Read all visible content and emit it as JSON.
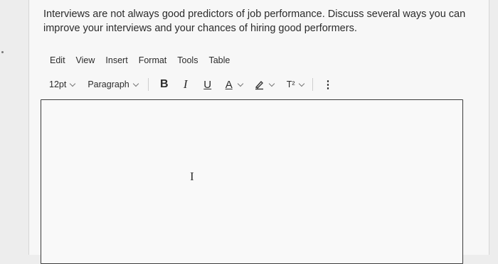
{
  "question": {
    "text": "Interviews are not always good predictors of job performance. Discuss several ways you can improve your interviews and your chances of hiring good performers."
  },
  "menubar": {
    "items": [
      "Edit",
      "View",
      "Insert",
      "Format",
      "Tools",
      "Table"
    ]
  },
  "toolbar": {
    "font_size": "12pt",
    "block_format": "Paragraph",
    "bold": "B",
    "italic": "I",
    "underline": "U",
    "text_color": "A",
    "superscript": "T²",
    "more": "⋮"
  },
  "editor": {
    "content": "",
    "text_cursor_glyph": "I"
  }
}
